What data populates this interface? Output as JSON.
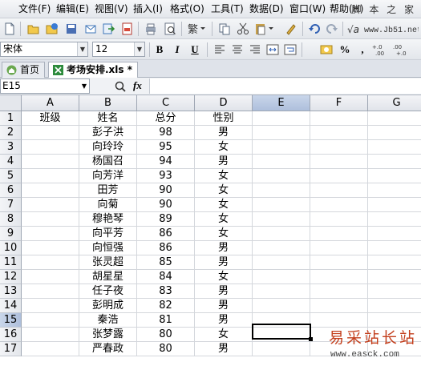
{
  "menu": [
    "文件(F)",
    "编辑(E)",
    "视图(V)",
    "插入(I)",
    "格式(O)",
    "工具(T)",
    "数据(D)",
    "窗口(W)",
    "帮助(H)"
  ],
  "watermark_top": "脚 本 之 家",
  "watermark_url_top": "www.Jb51.net",
  "toolbar2": {
    "font_name": "宋体",
    "font_size": "12",
    "bold": "B",
    "italic": "I",
    "underline": "U",
    "percent": "%"
  },
  "tabs": [
    {
      "label": "首页",
      "active": false
    },
    {
      "label": "考场安排.xls *",
      "active": true
    }
  ],
  "name_box": "E15",
  "fx_label": "fx",
  "columns": [
    "A",
    "B",
    "C",
    "D",
    "E",
    "F",
    "G"
  ],
  "selected_column": "E",
  "selected_row": "15",
  "row_numbers": [
    "1",
    "2",
    "3",
    "4",
    "5",
    "6",
    "7",
    "8",
    "9",
    "10",
    "11",
    "12",
    "13",
    "14",
    "15",
    "16",
    "17"
  ],
  "header_row": [
    "班级",
    "姓名",
    "总分",
    "性别"
  ],
  "rows": [
    [
      "",
      "彭子洪",
      "98",
      "男"
    ],
    [
      "",
      "向玲玲",
      "95",
      "女"
    ],
    [
      "",
      "杨国召",
      "94",
      "男"
    ],
    [
      "",
      "向芳洋",
      "93",
      "女"
    ],
    [
      "",
      "田芳",
      "90",
      "女"
    ],
    [
      "",
      "向菊",
      "90",
      "女"
    ],
    [
      "",
      "穆艳琴",
      "89",
      "女"
    ],
    [
      "",
      "向平芳",
      "86",
      "女"
    ],
    [
      "",
      "向恒强",
      "86",
      "男"
    ],
    [
      "",
      "张灵超",
      "85",
      "男"
    ],
    [
      "",
      "胡星星",
      "84",
      "女"
    ],
    [
      "",
      "任子夜",
      "83",
      "男"
    ],
    [
      "",
      "彭明成",
      "82",
      "男"
    ],
    [
      "",
      "秦浩",
      "81",
      "男"
    ],
    [
      "",
      "张梦露",
      "80",
      "女"
    ],
    [
      "",
      "严春政",
      "80",
      "男"
    ]
  ],
  "watermark_bottom": {
    "cn": "易采站长站",
    "url": "www.easck.com"
  }
}
